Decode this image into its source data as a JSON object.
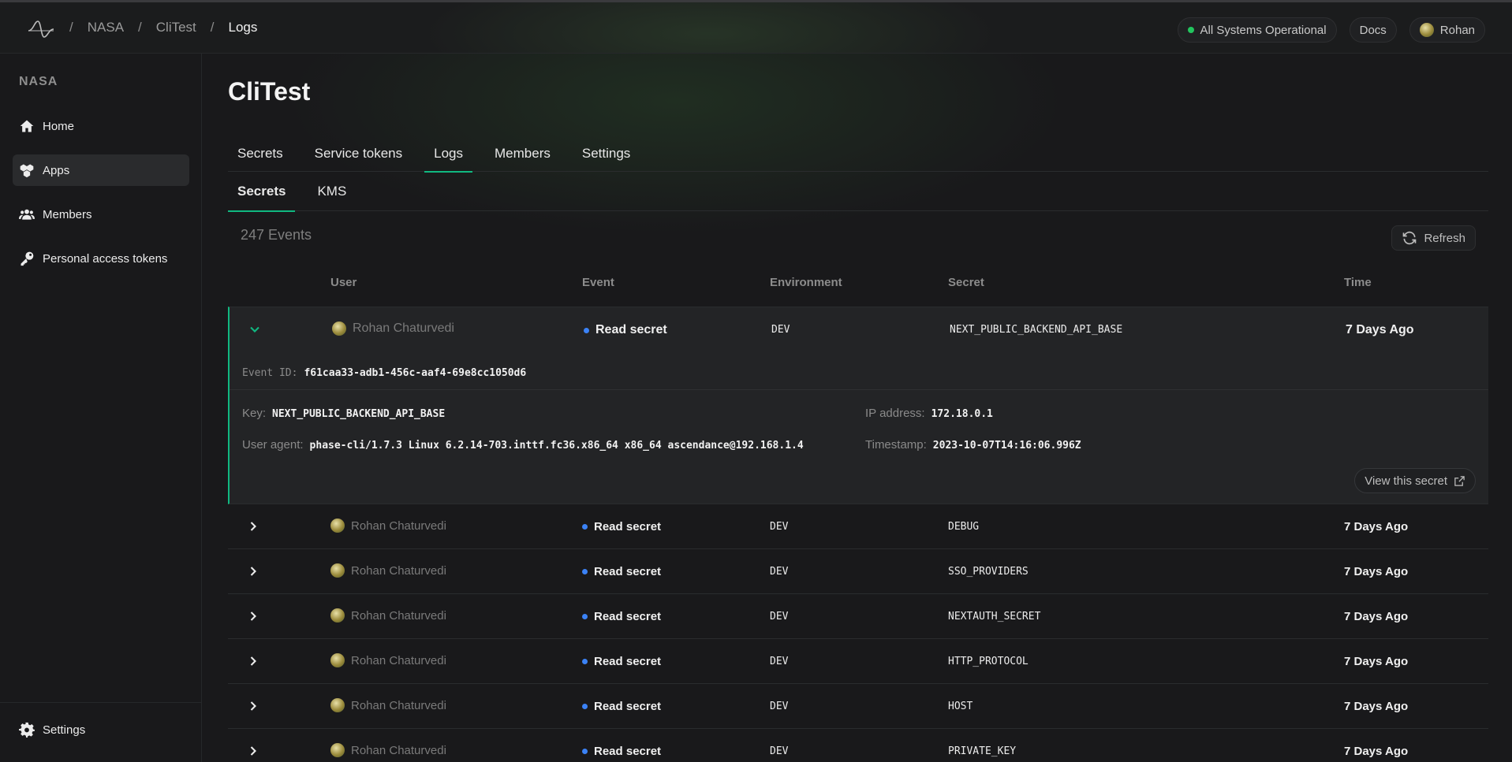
{
  "breadcrumbs": [
    "NASA",
    "CliTest",
    "Logs"
  ],
  "header": {
    "status": "All Systems Operational",
    "docs": "Docs",
    "user": "Rohan"
  },
  "sidebar": {
    "org": "NASA",
    "items": [
      {
        "label": "Home",
        "icon": "home-icon"
      },
      {
        "label": "Apps",
        "icon": "apps-icon",
        "active": true
      },
      {
        "label": "Members",
        "icon": "members-icon"
      },
      {
        "label": "Personal access tokens",
        "icon": "key-icon"
      }
    ],
    "settings": "Settings"
  },
  "page": {
    "title": "CliTest",
    "tabs": [
      "Secrets",
      "Service tokens",
      "Logs",
      "Members",
      "Settings"
    ],
    "active_tab": "Logs",
    "subtabs": [
      "Secrets",
      "KMS"
    ],
    "active_subtab": "Secrets",
    "events_count": "247 Events",
    "refresh": "Refresh"
  },
  "table": {
    "columns": [
      "User",
      "Event",
      "Environment",
      "Secret",
      "Time"
    ],
    "expanded": {
      "user": "Rohan Chaturvedi",
      "event": "Read secret",
      "environment": "DEV",
      "secret": "NEXT_PUBLIC_BACKEND_API_BASE",
      "time": "7 Days Ago",
      "event_id_label": "Event ID:",
      "event_id": "f61caa33-adb1-456c-aaf4-69e8cc1050d6",
      "key_label": "Key:",
      "key": "NEXT_PUBLIC_BACKEND_API_BASE",
      "ip_label": "IP address:",
      "ip": "172.18.0.1",
      "ua_label": "User agent:",
      "user_agent": "phase-cli/1.7.3 Linux 6.2.14-703.inttf.fc36.x86_64 x86_64 ascendance@192.168.1.4",
      "ts_label": "Timestamp:",
      "timestamp": "2023-10-07T14:16:06.996Z",
      "view_button": "View this secret"
    },
    "rows": [
      {
        "user": "Rohan Chaturvedi",
        "event": "Read secret",
        "environment": "DEV",
        "secret": "DEBUG",
        "time": "7 Days Ago"
      },
      {
        "user": "Rohan Chaturvedi",
        "event": "Read secret",
        "environment": "DEV",
        "secret": "SSO_PROVIDERS",
        "time": "7 Days Ago"
      },
      {
        "user": "Rohan Chaturvedi",
        "event": "Read secret",
        "environment": "DEV",
        "secret": "NEXTAUTH_SECRET",
        "time": "7 Days Ago"
      },
      {
        "user": "Rohan Chaturvedi",
        "event": "Read secret",
        "environment": "DEV",
        "secret": "HTTP_PROTOCOL",
        "time": "7 Days Ago"
      },
      {
        "user": "Rohan Chaturvedi",
        "event": "Read secret",
        "environment": "DEV",
        "secret": "HOST",
        "time": "7 Days Ago"
      },
      {
        "user": "Rohan Chaturvedi",
        "event": "Read secret",
        "environment": "DEV",
        "secret": "PRIVATE_KEY",
        "time": "7 Days Ago"
      }
    ]
  },
  "colors": {
    "accent": "#10b981",
    "status_green": "#22c55e",
    "event_blue": "#3b82f6",
    "background": "#19191b"
  }
}
